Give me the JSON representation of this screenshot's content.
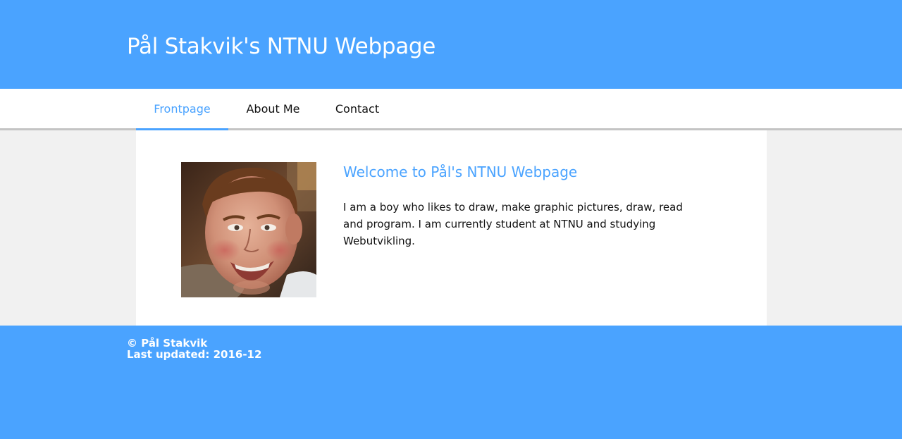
{
  "header": {
    "title": "Pål Stakvik's NTNU Webpage"
  },
  "nav": {
    "items": [
      {
        "label": "Frontpage",
        "active": true
      },
      {
        "label": "About Me",
        "active": false
      },
      {
        "label": "Contact",
        "active": false
      }
    ]
  },
  "main": {
    "heading": "Welcome to Pål's NTNU Webpage",
    "paragraph": "I am a boy who likes to draw, make graphic pictures, draw, read and program. I am currently student at NTNU and studying Webutvikling."
  },
  "footer": {
    "copyright": "© Pål Stakvik",
    "updated": "Last updated: 2016-12"
  },
  "colors": {
    "brand": "#4aa3ff",
    "page_background": "#f1f1f1",
    "nav_border": "#c4c4c4"
  }
}
